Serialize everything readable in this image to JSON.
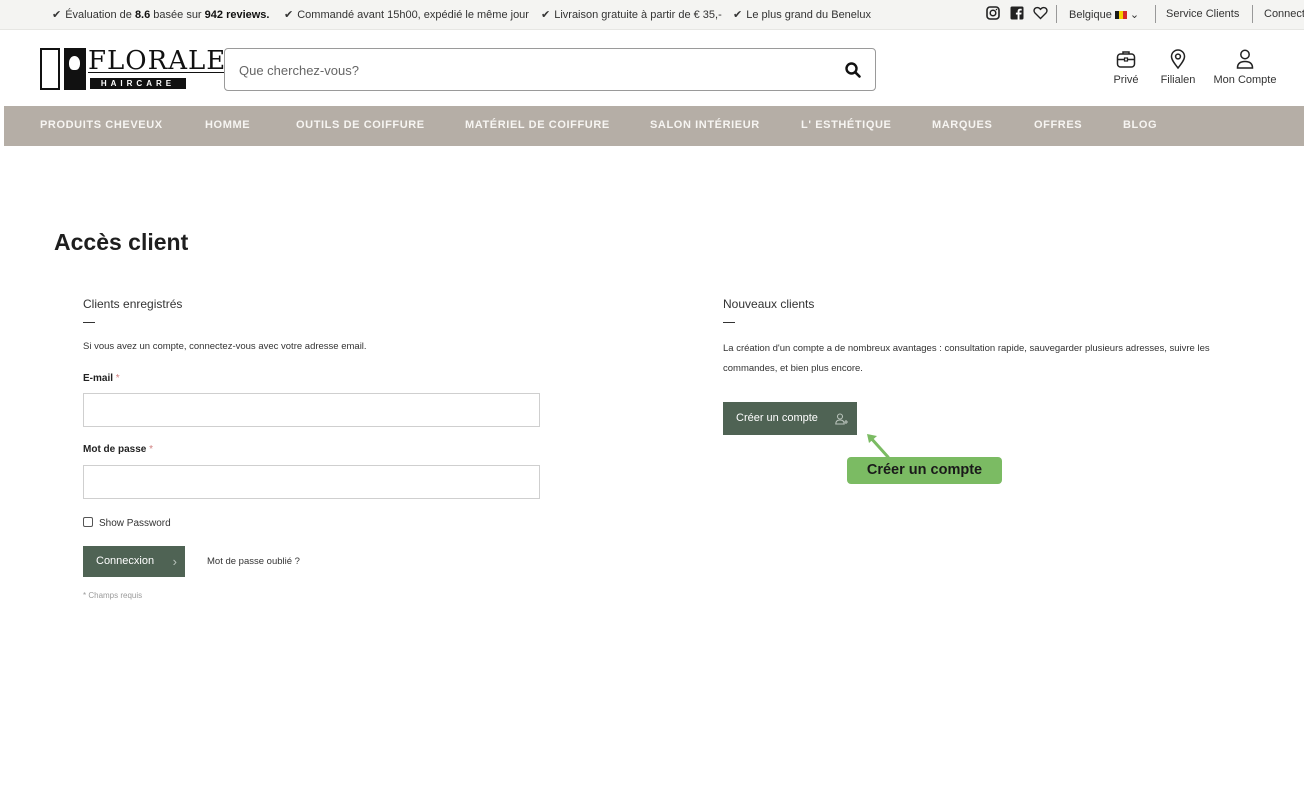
{
  "topbar": {
    "usps": [
      {
        "pre": "Évaluation de ",
        "b1": "8.6",
        "mid": " basée sur ",
        "b2": "942 reviews.",
        "post": ""
      },
      {
        "text": "Commandé avant 15h00, expédié le même jour"
      },
      {
        "text": "Livraison gratuite à partir de € 35,-"
      },
      {
        "text": "Le plus grand du Benelux"
      }
    ],
    "country": "Belgique",
    "service": "Service Clients",
    "connect": "Connect"
  },
  "logo": {
    "word": "FLORALE",
    "sub": "HAIRCARE"
  },
  "search": {
    "placeholder": "Que cherchez-vous?"
  },
  "header_icons": {
    "prive": "Privé",
    "filialen": "Filialen",
    "account": "Mon Compte"
  },
  "nav": [
    "PRODUITS CHEVEUX",
    "HOMME",
    "OUTILS DE COIFFURE",
    "MATÉRIEL DE COIFFURE",
    "SALON INTÉRIEUR",
    "L' ESTHÉTIQUE",
    "MARQUES",
    "OFFRES",
    "BLOG"
  ],
  "page": {
    "title": "Accès client"
  },
  "registered": {
    "title": "Clients enregistrés",
    "intro": "Si vous avez un compte, connectez-vous avec votre adresse email.",
    "email_label": "E-mail",
    "password_label": "Mot de passe",
    "required_mark": "*",
    "show_password": "Show Password",
    "login_button": "Connecxion",
    "forgot": "Mot de passe oublié ?",
    "required_note": "* Champs requis"
  },
  "new_customers": {
    "title": "Nouveaux clients",
    "text_line1": "La création d'un compte a de nombreux avantages : consultation rapide, sauvegarder plusieurs adresses, suivre les",
    "text_line2": "commandes, et bien plus encore.",
    "create_button": "Créer un compte"
  },
  "annotation": {
    "label": "Créer un compte"
  },
  "colors": {
    "nav_bg": "#b5aea6",
    "button_bg": "#4f6354",
    "tooltip_bg": "#7bbb63"
  }
}
